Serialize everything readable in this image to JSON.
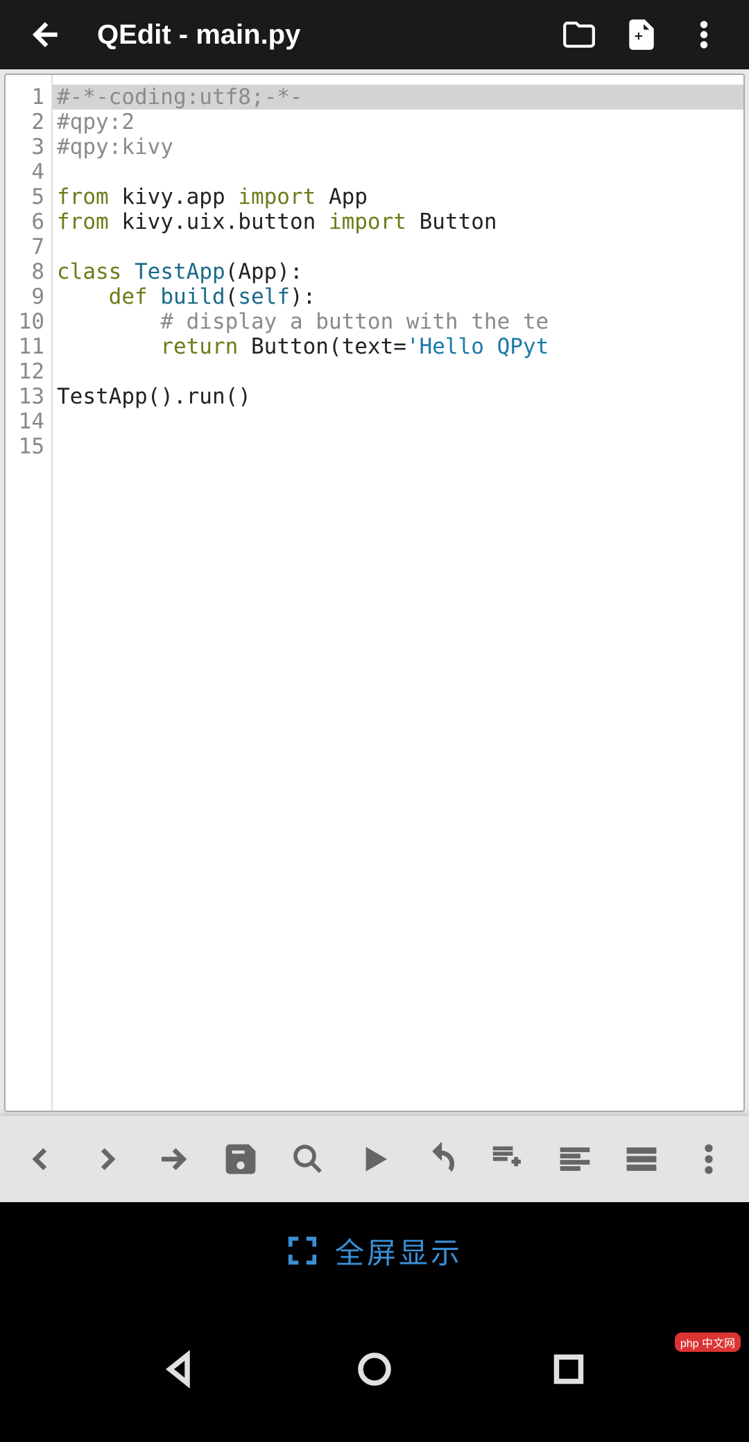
{
  "header": {
    "title": "QEdit - main.py"
  },
  "editor": {
    "line_count": 15,
    "highlighted_line": 1,
    "lines": [
      {
        "tokens": [
          {
            "t": "#-*-coding:utf8;-*-",
            "c": "cm"
          }
        ]
      },
      {
        "tokens": [
          {
            "t": "#qpy:2",
            "c": "cm"
          }
        ]
      },
      {
        "tokens": [
          {
            "t": "#qpy:kivy",
            "c": "cm"
          }
        ]
      },
      {
        "tokens": [
          {
            "t": "",
            "c": ""
          }
        ]
      },
      {
        "tokens": [
          {
            "t": "from",
            "c": "kw"
          },
          {
            "t": " kivy.app ",
            "c": ""
          },
          {
            "t": "import",
            "c": "kw"
          },
          {
            "t": " App",
            "c": ""
          }
        ]
      },
      {
        "tokens": [
          {
            "t": "from",
            "c": "kw"
          },
          {
            "t": " kivy.uix.button ",
            "c": ""
          },
          {
            "t": "import",
            "c": "kw"
          },
          {
            "t": " Button",
            "c": ""
          }
        ]
      },
      {
        "tokens": [
          {
            "t": "",
            "c": ""
          }
        ]
      },
      {
        "tokens": [
          {
            "t": "class",
            "c": "kw"
          },
          {
            "t": " ",
            "c": ""
          },
          {
            "t": "TestApp",
            "c": "fn"
          },
          {
            "t": "(App):",
            "c": ""
          }
        ]
      },
      {
        "tokens": [
          {
            "t": "    ",
            "c": ""
          },
          {
            "t": "def",
            "c": "kw"
          },
          {
            "t": " ",
            "c": ""
          },
          {
            "t": "build",
            "c": "fn"
          },
          {
            "t": "(",
            "c": ""
          },
          {
            "t": "self",
            "c": "bn"
          },
          {
            "t": "):",
            "c": ""
          }
        ]
      },
      {
        "tokens": [
          {
            "t": "        ",
            "c": ""
          },
          {
            "t": "# display a button with the te",
            "c": "cm"
          }
        ]
      },
      {
        "tokens": [
          {
            "t": "        ",
            "c": ""
          },
          {
            "t": "return",
            "c": "kw"
          },
          {
            "t": " Button(text=",
            "c": ""
          },
          {
            "t": "'Hello QPyt",
            "c": "st"
          }
        ]
      },
      {
        "tokens": [
          {
            "t": "",
            "c": ""
          }
        ]
      },
      {
        "tokens": [
          {
            "t": "TestApp().run()",
            "c": ""
          }
        ]
      },
      {
        "tokens": [
          {
            "t": "",
            "c": ""
          }
        ]
      },
      {
        "tokens": [
          {
            "t": "",
            "c": ""
          }
        ]
      }
    ]
  },
  "fullscreen": {
    "label": "全屏显示"
  },
  "watermark": "php 中文网"
}
